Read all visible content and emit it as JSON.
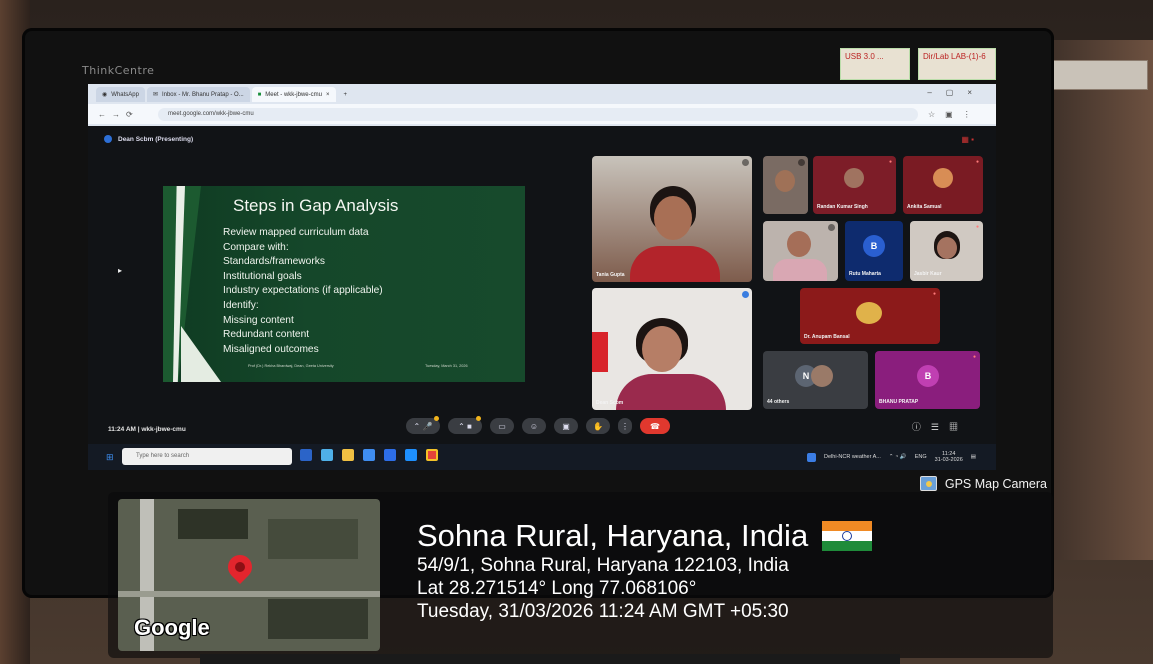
{
  "monitor": {
    "brand": "ThinkCentre",
    "note_left": "USB 3.0 ...",
    "note_right": "Dir/Lab LAB-(1)-6"
  },
  "browser": {
    "tabs": [
      {
        "label": "WhatsApp"
      },
      {
        "label": "Inbox - Mr. Bhanu Pratap - O..."
      },
      {
        "label": "Meet - wkk-jbwe-cmu"
      }
    ],
    "url": "meet.google.com/wkk-jbwe-cmu"
  },
  "meet": {
    "presenter_label": "Dean Scbm (Presenting)",
    "meeting_code": "wkk-jbwe-cmu",
    "time": "11:24 AM",
    "clock_line": "11:24 AM  |  wkk-jbwe-cmu"
  },
  "slide": {
    "title": "Steps in Gap Analysis",
    "lines": [
      "Review mapped curriculum data",
      "Compare with:",
      "Standards/frameworks",
      "Institutional goals",
      "Industry expectations (if applicable)",
      "Identify:",
      "Missing content",
      "Redundant content",
      "Misaligned outcomes"
    ],
    "footer_left": "Prof (Dr.) Rekha Bhardwaj, Dean, Geeta University",
    "footer_date": "Tuesday, March 31, 2026"
  },
  "participants": [
    {
      "name": "Tania Gupta"
    },
    {
      "name": ""
    },
    {
      "name": "Randan Kumar Singh"
    },
    {
      "name": "Ankita Samual"
    },
    {
      "name": ""
    },
    {
      "name": "Rutu Maharta",
      "initial": "B"
    },
    {
      "name": "Jasbir Kaur"
    },
    {
      "name": "Dr. Anupam Bansal"
    },
    {
      "name": "Dean Scbm"
    },
    {
      "name": "44 others",
      "initial": "N"
    },
    {
      "name": "BHANU PRATAP",
      "initial": "B"
    }
  ],
  "taskbar": {
    "search_placeholder": "Type here to search",
    "weather": "Delhi-NCR weather A...",
    "lang": "ENG",
    "clock_time": "11:24",
    "clock_date": "31-03-2026"
  },
  "gps": {
    "camera_label": "GPS Map Camera",
    "place": "Sohna Rural, Haryana, India",
    "address": "54/9/1, Sohna Rural, Haryana 122103, India",
    "coords": "Lat 28.271514° Long 77.068106°",
    "datetime": "Tuesday, 31/03/2026 11:24 AM GMT +05:30",
    "map_brand": "Google"
  },
  "colors": {
    "slide_green": "#15472a",
    "end_call_red": "#e0382e",
    "pin_red": "#e3252d",
    "accent_blue": "#2d6fd6"
  }
}
